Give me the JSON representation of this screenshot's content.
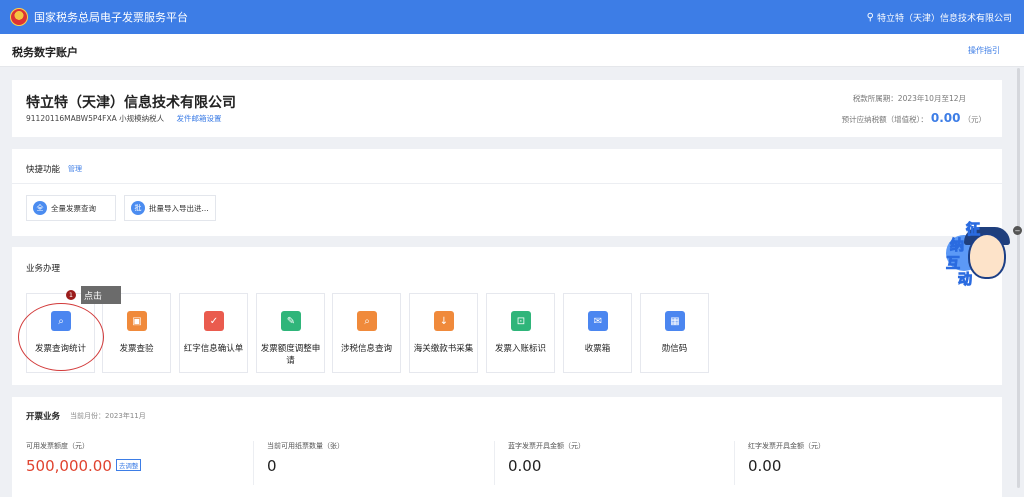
{
  "header": {
    "title": "国家税务总局电子发票服务平台",
    "user": "特立特（天津）信息技术有限公司"
  },
  "subheader": {
    "title": "税务数字账户",
    "guide": "操作指引"
  },
  "company": {
    "name": "特立特（天津）信息技术有限公司",
    "tax_id_type": "91120116MABW5P4FXA 小规模纳税人",
    "mail_setting": "发件邮箱设置",
    "period": "税款所属期：2023年10月至12月",
    "tax_label": "预计应纳税额（增值税）：",
    "tax_value": "0.00",
    "tax_unit": "（元）"
  },
  "quick": {
    "title": "快捷功能",
    "manage": "管理",
    "items": [
      {
        "icon": "全",
        "label": "全量发票查询"
      },
      {
        "icon": "批",
        "label": "批量导入导出进..."
      }
    ]
  },
  "business": {
    "title": "业务办理",
    "tooltip": "点击",
    "badge": "1",
    "tiles": [
      {
        "label": "发票查询统计",
        "icon": "search-doc-icon",
        "color": "#4b86f0"
      },
      {
        "label": "发票查验",
        "icon": "scan-icon",
        "color": "#f08a3b"
      },
      {
        "label": "红字信息确认单",
        "icon": "document-check-icon",
        "color": "#ea5b4e"
      },
      {
        "label": "发票额度调整申请",
        "icon": "edit-doc-icon",
        "color": "#2fb57a"
      },
      {
        "label": "涉税信息查询",
        "icon": "folder-search-icon",
        "color": "#f08a3b"
      },
      {
        "label": "海关缴款书采集",
        "icon": "download-doc-icon",
        "color": "#f08a3b"
      },
      {
        "label": "发票入账标识",
        "icon": "stamp-icon",
        "color": "#2fb57a"
      },
      {
        "label": "收票箱",
        "icon": "mailbox-icon",
        "color": "#4b86f0"
      },
      {
        "label": "勋信码",
        "icon": "qrcode-icon",
        "color": "#4b86f0"
      }
    ]
  },
  "mascot": {
    "chars": [
      "征",
      "纳",
      "互",
      "动"
    ]
  },
  "invoice": {
    "title": "开票业务",
    "month": "当前月份：2023年11月",
    "stats": [
      {
        "label": "可用发票额度（元）",
        "value": "500,000.00",
        "action": "去调整"
      },
      {
        "label": "当前可用纸票数量（张）",
        "value": "0"
      },
      {
        "label": "蓝字发票开具金额（元）",
        "value": "0.00"
      },
      {
        "label": "红字发票开具金额（元）",
        "value": "0.00"
      }
    ]
  }
}
